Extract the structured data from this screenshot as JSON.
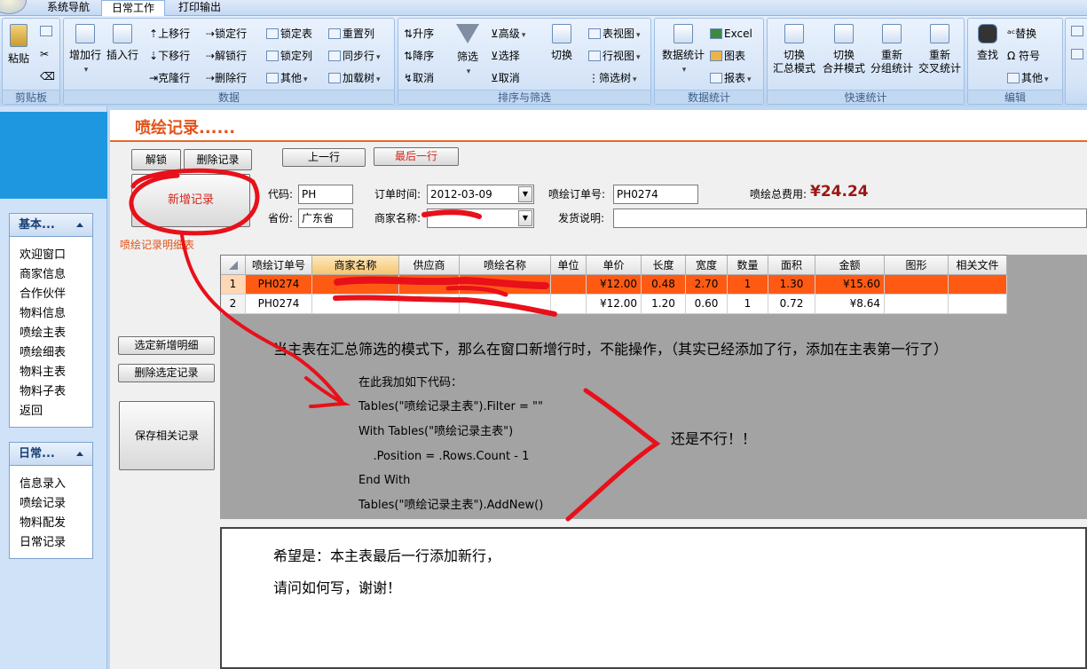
{
  "tabs": {
    "nav": "系统导航",
    "daily": "日常工作",
    "print": "打印输出"
  },
  "ribbon": {
    "clipboard": {
      "title": "剪贴板",
      "paste": "粘贴"
    },
    "data": {
      "title": "数据",
      "add_row": "增加行",
      "insert_row": "插入行",
      "move_up": "上移行",
      "move_down": "下移行",
      "clone_row": "克隆行",
      "lock_row": "锁定行",
      "unlock_row": "解锁行",
      "delete_row": "删除行",
      "lock_table": "锁定表",
      "lock_col": "锁定列",
      "other": "其他",
      "reset_cols": "重置列",
      "sync_rows": "同步行",
      "load_tree": "加载树"
    },
    "sort": {
      "title": "排序与筛选",
      "asc": "升序",
      "desc": "降序",
      "cancel": "取消",
      "filter": "筛选",
      "advanced": "高级",
      "select": "选择",
      "cancel2": "取消",
      "switch": "切换",
      "table_view": "表视图",
      "row_view": "行视图",
      "filter_tree": "筛选树"
    },
    "stats": {
      "title": "数据统计",
      "data_stats": "数据统计",
      "excel": "Excel",
      "chart": "图表",
      "report": "报表"
    },
    "quick": {
      "title": "快速统计",
      "summary_mode": [
        "切换",
        "汇总模式"
      ],
      "merge_mode": [
        "切换",
        "合并模式"
      ],
      "regroup": [
        "重新",
        "分组统计"
      ],
      "crosstab": [
        "重新",
        "交叉统计"
      ]
    },
    "edit": {
      "title": "编辑",
      "find": "查找",
      "replace": "替换",
      "symbol": "符号",
      "other": "其他"
    }
  },
  "nav": {
    "group1": {
      "title": "基本...",
      "items": [
        "欢迎窗口",
        "商家信息",
        "合作伙伴",
        "物料信息",
        "喷绘主表",
        "喷绘细表",
        "物料主表",
        "物料子表",
        "返回"
      ]
    },
    "group2": {
      "title": "日常...",
      "items": [
        "信息录入",
        "喷绘记录",
        "物料配发",
        "日常记录"
      ]
    }
  },
  "form": {
    "title": "喷绘记录......",
    "unlock": "解锁",
    "delete": "删除记录",
    "prev": "上一行",
    "last": "最后一行",
    "new_record": "新增记录",
    "detail_label": "喷绘记录明细表",
    "code_label": "代码:",
    "code": "PH",
    "province_label": "省份:",
    "province": "广东省",
    "order_time_label": "订单时间:",
    "order_time": "2012-03-09",
    "merchant_label": "商家名称:",
    "merchant": "",
    "order_no_label": "喷绘订单号:",
    "order_no": "PH0274",
    "total_label": "喷绘总费用:",
    "total": "¥24.24",
    "ship_label": "发货说明:",
    "ship": "",
    "select_detail": "选定新增明细",
    "delete_selected": "删除选定记录",
    "save_related": "保存相关记录"
  },
  "grid": {
    "headers": [
      "喷绘订单号",
      "商家名称",
      "供应商",
      "喷绘名称",
      "单位",
      "单价",
      "长度",
      "宽度",
      "数量",
      "面积",
      "金额",
      "图形",
      "相关文件"
    ],
    "rows": [
      {
        "n": "1",
        "order": "PH0274",
        "merchant": "",
        "supplier": "",
        "name": "",
        "unit": "",
        "price": "¥12.00",
        "length": "0.48",
        "width": "2.70",
        "qty": "1",
        "area": "1.30",
        "amount": "¥15.60",
        "shape": "",
        "file": ""
      },
      {
        "n": "2",
        "order": "PH0274",
        "merchant": "",
        "supplier": "",
        "name": "",
        "unit": "",
        "price": "¥12.00",
        "length": "1.20",
        "width": "0.60",
        "qty": "1",
        "area": "0.72",
        "amount": "¥8.64",
        "shape": "",
        "file": ""
      }
    ]
  },
  "annotation": {
    "main": "当主表在汇总筛选的模式下，那么在窗口新增行时，不能操作，（其实已经添加了行，添加在主表第一行了）",
    "code_intro": "在此我加如下代码：",
    "code": [
      "Tables(\"喷绘记录主表\").Filter = \"\"",
      "With Tables(\"喷绘记录主表\")",
      "    .Position = .Rows.Count - 1",
      "End With",
      "Tables(\"喷绘记录主表\").AddNew()"
    ],
    "still": "还是不行！！",
    "hope": "希望是：本主表最后一行添加新行，",
    "ask": "请问如何写，谢谢！"
  },
  "colors": {
    "accent": "#e2541b",
    "row_highlight": "#ff5a14",
    "scribble": "#e8101a"
  }
}
